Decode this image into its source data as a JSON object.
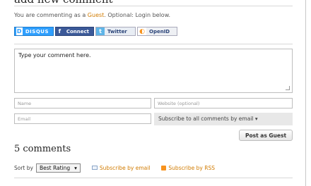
{
  "section": {
    "heading": "add new comment"
  },
  "identity": {
    "prefix": "You are commenting as a ",
    "guest": "Guest",
    "suffix": ". Optional: Login below."
  },
  "login_buttons": [
    {
      "label": "DISQUS",
      "icon": "disqus-icon",
      "glyph": "D"
    },
    {
      "label": "Connect",
      "icon": "facebook-icon",
      "glyph": "f"
    },
    {
      "label": "Twitter",
      "icon": "twitter-icon",
      "glyph": "t"
    },
    {
      "label": "OpenID",
      "icon": "openid-icon",
      "glyph": "◐"
    }
  ],
  "form": {
    "comment_placeholder": "Type your comment here.",
    "name_placeholder": "Name",
    "website_placeholder": "Website (optional)",
    "email_placeholder": "Email",
    "subscribe_label": "Subscribe to all comments by email ▾",
    "post_button": "Post as Guest"
  },
  "comments": {
    "count_label": "5 comments",
    "sort_by_label": "Sort by",
    "sort_selected": "Best Rating",
    "subscribe_email": "Subscribe by email",
    "subscribe_rss": "Subscribe by RSS"
  },
  "colors": {
    "accent": "#d17b00",
    "disqus": "#2e9fff",
    "facebook": "#3b5998"
  }
}
